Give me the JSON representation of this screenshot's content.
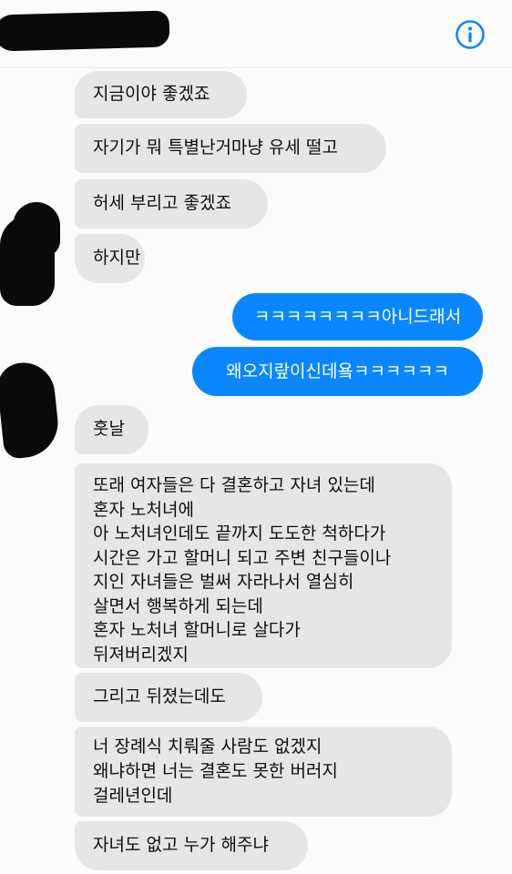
{
  "header": {
    "info_icon": "info-circle-icon",
    "accent_color": "#0a86ff"
  },
  "messages": [
    {
      "from": "them",
      "text": "지금이야 좋겠죠"
    },
    {
      "from": "them",
      "text": "자기가 뭐 특별난거마냥 유세 떨고"
    },
    {
      "from": "them",
      "text": "허세 부리고 좋겠죠"
    },
    {
      "from": "them",
      "text": "하지만"
    },
    {
      "from": "me",
      "text": "ㅋㅋㅋㅋㅋㅋㅋㅋ아니드래서"
    },
    {
      "from": "me",
      "text": "왜오지랖이신데욬ㅋㅋㅋㅋㅋㅋ"
    },
    {
      "from": "them",
      "text": "훗날"
    },
    {
      "from": "them",
      "text": "또래 여자들은 다 결혼하고 자녀 있는데\n혼자 노처녀에\n아 노처녀인데도 끝까지 도도한 척하다가\n시간은 가고 할머니 되고 주변 친구들이나\n지인 자녀들은 벌써 자라나서 열심히\n살면서 행복하게 되는데\n혼자 노처녀 할머니로 살다가\n뒤져버리겠지"
    },
    {
      "from": "them",
      "text": "그리고 뒤졌는데도"
    },
    {
      "from": "them",
      "text": "너 장례식 치뤄줄 사람도 없겠지\n왜냐하면 너는 결혼도 못한 버러지\n걸레년인데"
    },
    {
      "from": "them",
      "text": "자녀도 없고 누가 해주냐"
    }
  ]
}
